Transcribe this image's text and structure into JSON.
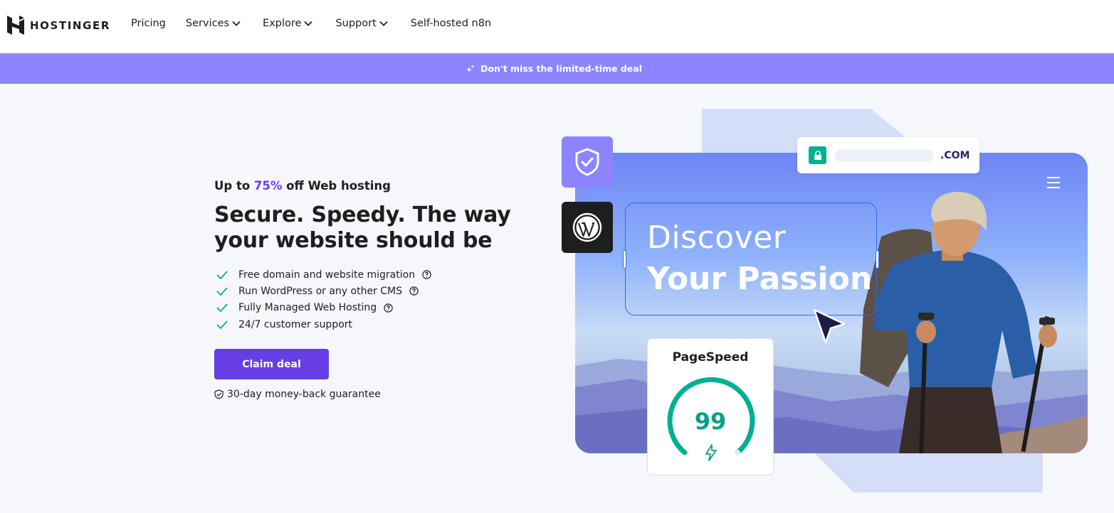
{
  "header": {
    "brand": "HOSTINGER",
    "nav": [
      {
        "label": "Pricing",
        "has_dropdown": false
      },
      {
        "label": "Services",
        "has_dropdown": true
      },
      {
        "label": "Explore",
        "has_dropdown": true
      },
      {
        "label": "Support",
        "has_dropdown": true
      },
      {
        "label": "Self-hosted n8n",
        "has_dropdown": false
      }
    ]
  },
  "promo": {
    "text": "Don't miss the limited-time deal",
    "icon": "sparkles-icon"
  },
  "hero": {
    "eyebrow_prefix": "Up to ",
    "eyebrow_accent": "75%",
    "eyebrow_suffix": " off Web hosting",
    "headline": "Secure. Speedy. The way your website should be",
    "features": [
      {
        "text": "Free domain and website migration",
        "has_help": true
      },
      {
        "text": "Run WordPress or any other CMS",
        "has_help": true
      },
      {
        "text": "Fully Managed Web Hosting",
        "has_help": true
      },
      {
        "text": "24/7 customer support",
        "has_help": false
      }
    ],
    "cta_label": "Claim deal",
    "guarantee": "30-day money-back guarantee"
  },
  "illustration": {
    "url_tld": ".COM",
    "line1": "Discover",
    "line2": "Your Passion",
    "pagespeed_title": "PageSpeed",
    "pagespeed_score": "99"
  },
  "colors": {
    "accent": "#673de6",
    "promo_bg": "#8c85ff",
    "score_green": "#00a28a"
  }
}
